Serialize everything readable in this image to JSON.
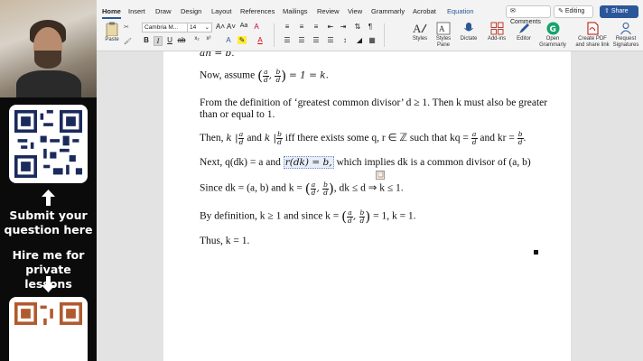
{
  "sidebar": {
    "submit_text": "Submit your question here",
    "hire_text": "Hire me for private lessons"
  },
  "ribbon": {
    "tabs": [
      "Home",
      "Insert",
      "Draw",
      "Design",
      "Layout",
      "References",
      "Mailings",
      "Review",
      "View",
      "Grammarly",
      "Acrobat",
      "Equation"
    ],
    "active_tab": "Home",
    "comments_label": "Comments",
    "editing_label": "Editing",
    "share_label": "Share",
    "paste_label": "Paste",
    "font_name": "Cambria M...",
    "font_size": "14",
    "styles_label": "Styles",
    "styles_pane_label": "Styles Pane",
    "dictate_label": "Dictate",
    "addins_label": "Add-ins",
    "editor_label": "Editor",
    "grammarly_label": "Open Grammarly",
    "pdf_label": "Create PDF and share link",
    "signatures_label": "Request Signatures"
  },
  "document": {
    "line_top": "an = b.",
    "now_assume_prefix": "Now, assume",
    "now_assume_suffix": "= 1 = k.",
    "gcd_line1": "From the definition of ‘greatest common divisor’ d ≥ 1. Then k must also be greater",
    "gcd_line2": "than or equal to 1.",
    "then_prefix": "Then,",
    "then_mid": "iff there exists some q, r ∈ ℤ such that kq =",
    "then_and": "and kr =",
    "next_prefix": "Next, q(dk) = a and",
    "next_box": "r(dk) = b,",
    "next_suffix": "which implies dk is a common divisor of (a, b)",
    "since_prefix": "Since dk = (a, b) and k =",
    "since_suffix": ", dk ≤ d ⇒ k ≤ 1.",
    "bydef_prefix": "By definition, k ≥ 1 and since k =",
    "bydef_suffix": "= 1, k = 1.",
    "thus_line": "Thus, k = 1."
  }
}
